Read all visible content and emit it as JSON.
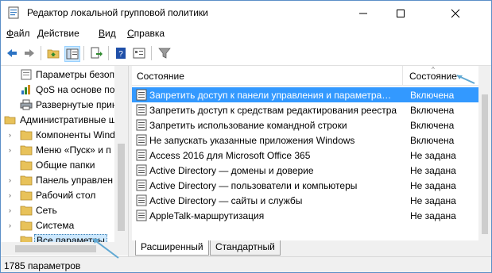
{
  "window": {
    "title": "Редактор локальной групповой политики"
  },
  "menu": [
    {
      "label": "Файл",
      "underline": "Ф",
      "rest": "айл"
    },
    {
      "label": "Действие",
      "underline": "Д",
      "rest": "ействие"
    },
    {
      "label": "Вид",
      "underline": "В",
      "rest": "ид"
    },
    {
      "label": "Справка",
      "underline": "С",
      "rest": "правка"
    }
  ],
  "toolbar": [
    "back-icon",
    "forward-icon",
    "up-folder-icon",
    "show-hide-tree-icon",
    "export-list-icon",
    "help-icon",
    "properties-view-icon",
    "filter-icon"
  ],
  "tree": {
    "items": [
      {
        "label": "Параметры безопасности",
        "shown": "Параметры безоп"
      },
      {
        "label": "QoS на основе политики",
        "shown": "QoS на основе по"
      },
      {
        "label": "Развернутые принтеры",
        "shown": "Развернутые прин"
      },
      {
        "label": "Административные шаблоны",
        "shown": "Административные ш"
      },
      {
        "label": "Компоненты Windows",
        "shown": "Компоненты Windo"
      },
      {
        "label": "Меню «Пуск» и панель задач",
        "shown": "Меню «Пуск» и п"
      },
      {
        "label": "Общие папки",
        "shown": "Общие папки"
      },
      {
        "label": "Панель управления",
        "shown": "Панель управлен"
      },
      {
        "label": "Рабочий стол",
        "shown": "Рабочий стол"
      },
      {
        "label": "Сеть",
        "shown": "Сеть"
      },
      {
        "label": "Система",
        "shown": "Система"
      },
      {
        "label": "Все параметры",
        "shown": "Все параметры"
      }
    ]
  },
  "list": {
    "col_name": "Состояние",
    "col_state": "Состояние",
    "rows": [
      {
        "name": "Запретить доступ к панели управления и параметра…",
        "state": "Включена"
      },
      {
        "name": "Запретить доступ к средствам редактирования реестра",
        "state": "Включена"
      },
      {
        "name": "Запретить использование командной строки",
        "state": "Включена"
      },
      {
        "name": "Не запускать указанные приложения Windows",
        "state": "Включена"
      },
      {
        "name": "Access 2016 для Microsoft Office 365",
        "state": "Не задана"
      },
      {
        "name": "Active Directory — домены и доверие",
        "state": "Не задана"
      },
      {
        "name": "Active Directory — пользователи и компьютеры",
        "state": "Не задана"
      },
      {
        "name": "Active Directory — сайты и службы",
        "state": "Не задана"
      },
      {
        "name": "AppleTalk-маршрутизация",
        "state": "Не задана"
      }
    ]
  },
  "tabs": [
    {
      "label": "Расширенный"
    },
    {
      "label": "Стандартный"
    }
  ],
  "status": {
    "text": "1785 параметров"
  },
  "colors": {
    "selection": "#3399ff",
    "accent": "#2b73c4",
    "cursor": "#5fa8d3"
  }
}
